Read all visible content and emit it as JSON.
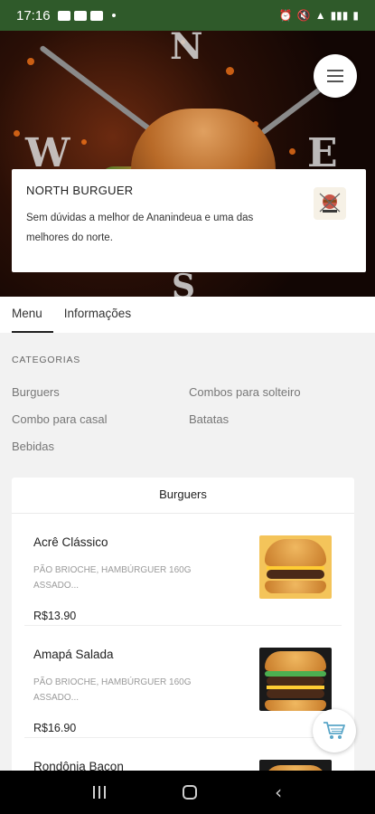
{
  "status_bar": {
    "time": "17:16",
    "icons": [
      "notification-icon",
      "alarm-icon",
      "mute-icon",
      "wifi-icon",
      "lte-icon",
      "signal-icon",
      "battery-icon"
    ]
  },
  "restaurant": {
    "name": "NORTH BURGUER",
    "description": "Sem dúvidas a melhor de Ananindeua e uma das melhores do norte."
  },
  "hero": {
    "compass_letters": [
      "N",
      "W",
      "E",
      "S"
    ]
  },
  "tabs": [
    {
      "label": "Menu",
      "active": true
    },
    {
      "label": "Informações",
      "active": false
    }
  ],
  "categories": {
    "heading": "CATEGORIAS",
    "items": [
      "Burguers",
      "Combos para solteiro",
      "Combo para casal",
      "Batatas",
      "Bebidas"
    ]
  },
  "section": {
    "title": "Burguers",
    "products": [
      {
        "name": "Acrê Clássico",
        "description": "PÃO BRIOCHE, HAMBÚRGUER 160G ASSADO...",
        "price": "R$13.90"
      },
      {
        "name": "Amapá Salada",
        "description": "PÃO BRIOCHE, HAMBÚRGUER 160G ASSADO...",
        "price": "R$16.90"
      },
      {
        "name": "Rondônia Bacon",
        "description": "",
        "price": ""
      }
    ]
  },
  "colors": {
    "status_bar": "#2f5a2a",
    "background": "#f2f2f2",
    "accent": "#1f1f1f"
  }
}
